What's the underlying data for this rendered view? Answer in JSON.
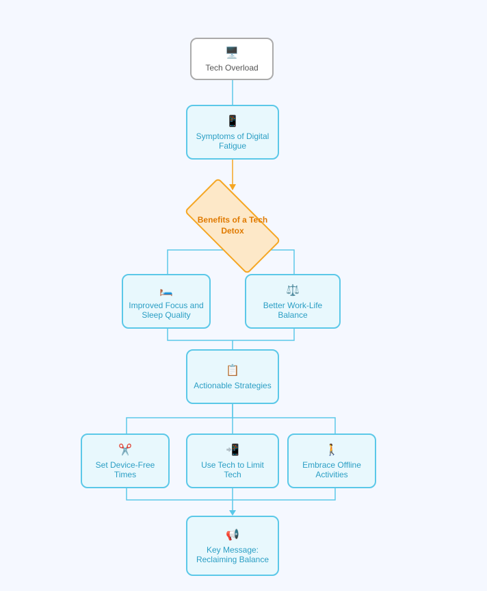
{
  "nodes": {
    "tech_overload": {
      "label": "Tech Overload",
      "icon": "🖥️"
    },
    "symptoms": {
      "label": "Symptoms of Digital Fatigue",
      "icon": "📱"
    },
    "benefits": {
      "label": "Benefits of a Tech Detox"
    },
    "improved_focus": {
      "label": "Improved Focus and Sleep Quality",
      "icon": "🛏️"
    },
    "better_work": {
      "label": "Better Work-Life Balance",
      "icon": "⚖️"
    },
    "actionable": {
      "label": "Actionable Strategies",
      "icon": "📋"
    },
    "device_free": {
      "label": "Set Device-Free Times",
      "icon": "✂️"
    },
    "use_tech": {
      "label": "Use Tech to Limit Tech",
      "icon": "📲"
    },
    "offline": {
      "label": "Embrace Offline Activities",
      "icon": "🚶"
    },
    "key_message": {
      "label": "Key Message: Reclaiming Balance",
      "icon": "📢"
    }
  }
}
